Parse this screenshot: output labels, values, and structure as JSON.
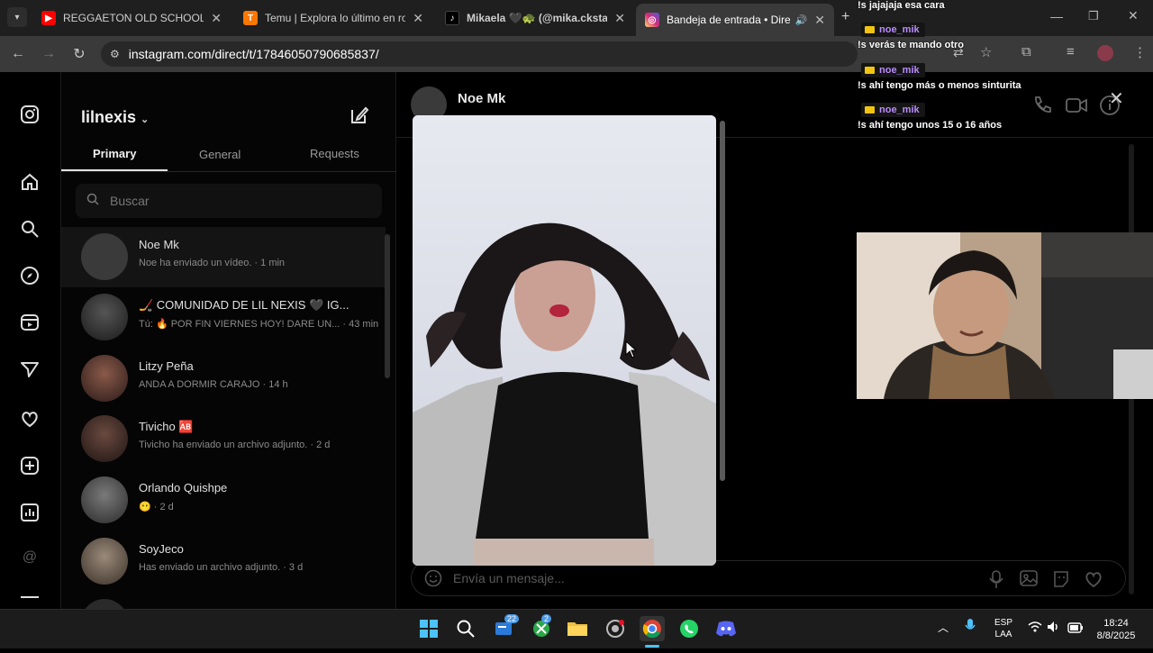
{
  "browser": {
    "tabs": [
      {
        "title": "REGGAETON OLD SCHOOL VS",
        "icon": "youtube-icon",
        "color": "#ff0000"
      },
      {
        "title": "Temu | Explora lo último en ropa",
        "icon": "temu-icon",
        "color": "#fb7701"
      },
      {
        "title": "Mikaela 🖤🐢 (@mika.ckstar) |",
        "icon": "tiktok-icon",
        "color": "#000000"
      },
      {
        "title": "Bandeja de entrada • Direct",
        "icon": "instagram-icon",
        "color": "#d62976"
      }
    ],
    "url": "instagram.com/direct/t/17846050790685837/"
  },
  "instagram": {
    "username": "lilnexis",
    "tabs": [
      "Primary",
      "General",
      "Requests"
    ],
    "search_placeholder": "Buscar",
    "conversations": [
      {
        "name": "Noe Mk",
        "preview": "Noe ha enviado un vídeo. · 1 min"
      },
      {
        "name": "🏒 COMUNIDAD DE LIL NEXIS 🖤 IG...",
        "preview": "Tú: 🔥 POR FIN VIERNES HOY! DARE UN... · 43 min"
      },
      {
        "name": "Litzy Peña",
        "preview": "ANDA A DORMIR CARAJO · 14 h"
      },
      {
        "name": "Tivicho 🆎",
        "preview": "Tivicho ha enviado un archivo adjunto. · 2 d"
      },
      {
        "name": "Orlando Quishpe",
        "preview": "😶 · 2 d"
      },
      {
        "name": "SoyJeco",
        "preview": "Has enviado un archivo adjunto. · 3 d"
      }
    ],
    "chat": {
      "contact": "Noe Mk",
      "message_placeholder": "Envía un mensaje..."
    }
  },
  "stream_chat": [
    {
      "type": "msg",
      "text": "!s jajajaja esa cara"
    },
    {
      "type": "user",
      "text": "noe_mik"
    },
    {
      "type": "msg",
      "text": "!s verás te mando otro"
    },
    {
      "type": "user",
      "text": "noe_mik"
    },
    {
      "type": "msg",
      "text": "!s ahí tengo más o menos sinturita"
    },
    {
      "type": "user",
      "text": "noe_mik"
    },
    {
      "type": "msg",
      "text": "!s ahí tengo unos 15 o 16 años"
    }
  ],
  "taskbar": {
    "badges": {
      "chat": "22",
      "xbox": "2"
    },
    "lang": "ESP",
    "layout": "LAA",
    "time": "18:24",
    "date": "8/8/2025"
  }
}
